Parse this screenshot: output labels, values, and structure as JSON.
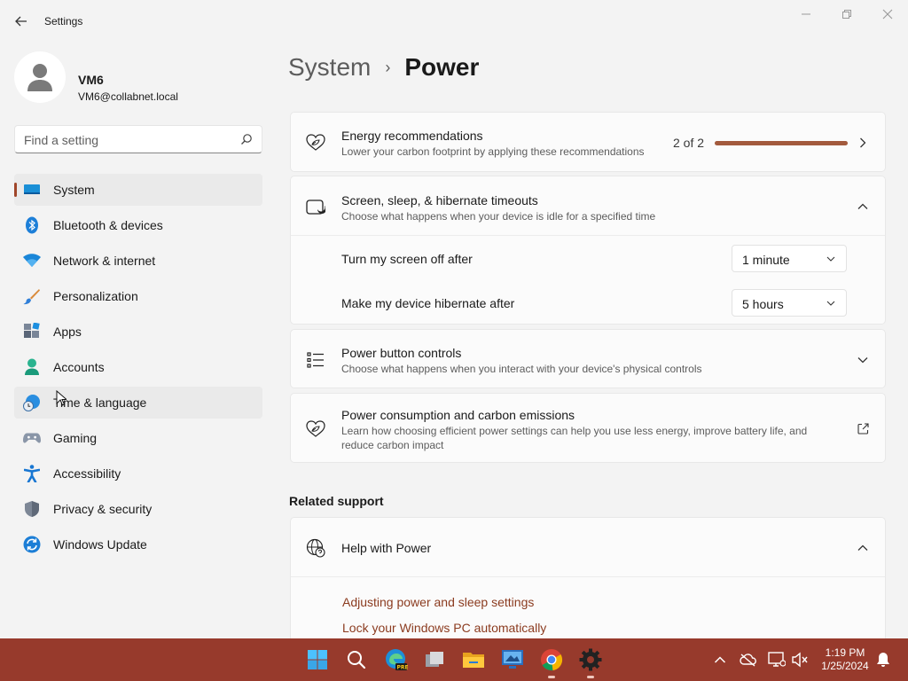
{
  "window": {
    "title": "Settings"
  },
  "user": {
    "name": "VM6",
    "email": "VM6@collabnet.local"
  },
  "search": {
    "placeholder": "Find a setting"
  },
  "sidebar": {
    "items": [
      {
        "label": "System",
        "icon": "system-icon",
        "selected": true
      },
      {
        "label": "Bluetooth & devices",
        "icon": "bluetooth-icon"
      },
      {
        "label": "Network & internet",
        "icon": "wifi-icon"
      },
      {
        "label": "Personalization",
        "icon": "brush-icon"
      },
      {
        "label": "Apps",
        "icon": "apps-icon"
      },
      {
        "label": "Accounts",
        "icon": "accounts-icon"
      },
      {
        "label": "Time & language",
        "icon": "globe-clock-icon",
        "hovered": true
      },
      {
        "label": "Gaming",
        "icon": "gamepad-icon"
      },
      {
        "label": "Accessibility",
        "icon": "accessibility-icon"
      },
      {
        "label": "Privacy & security",
        "icon": "shield-icon"
      },
      {
        "label": "Windows Update",
        "icon": "update-icon"
      }
    ]
  },
  "breadcrumb": {
    "parent": "System",
    "separator": "›",
    "current": "Power"
  },
  "cards": {
    "energy": {
      "title": "Energy recommendations",
      "desc": "Lower your carbon footprint by applying these recommendations",
      "count": "2 of 2",
      "progress": 1.0
    },
    "timeouts": {
      "title": "Screen, sleep, & hibernate timeouts",
      "desc": "Choose what happens when your device is idle for a specified time",
      "screen_off_label": "Turn my screen off after",
      "screen_off_value": "1 minute",
      "hibernate_label": "Make my device hibernate after",
      "hibernate_value": "5 hours"
    },
    "power_button": {
      "title": "Power button controls",
      "desc": "Choose what happens when you interact with your device's physical controls"
    },
    "consumption": {
      "title": "Power consumption and carbon emissions",
      "desc": "Learn how choosing efficient power settings can help you use less energy, improve battery life, and reduce carbon impact"
    }
  },
  "related": {
    "heading": "Related support",
    "help_title": "Help with Power",
    "links": [
      "Adjusting power and sleep settings",
      "Lock your Windows PC automatically"
    ]
  },
  "taskbar": {
    "apps": [
      "start-icon",
      "search-icon",
      "edge-icon",
      "task-view-icon",
      "file-explorer-icon",
      "remote-desktop-icon",
      "chrome-icon",
      "settings-gear-icon"
    ],
    "time": "1:19 PM",
    "date": "1/25/2024"
  },
  "colors": {
    "accent": "#a0462a",
    "taskbar": "#973a2c",
    "link": "#8b3b1f"
  }
}
